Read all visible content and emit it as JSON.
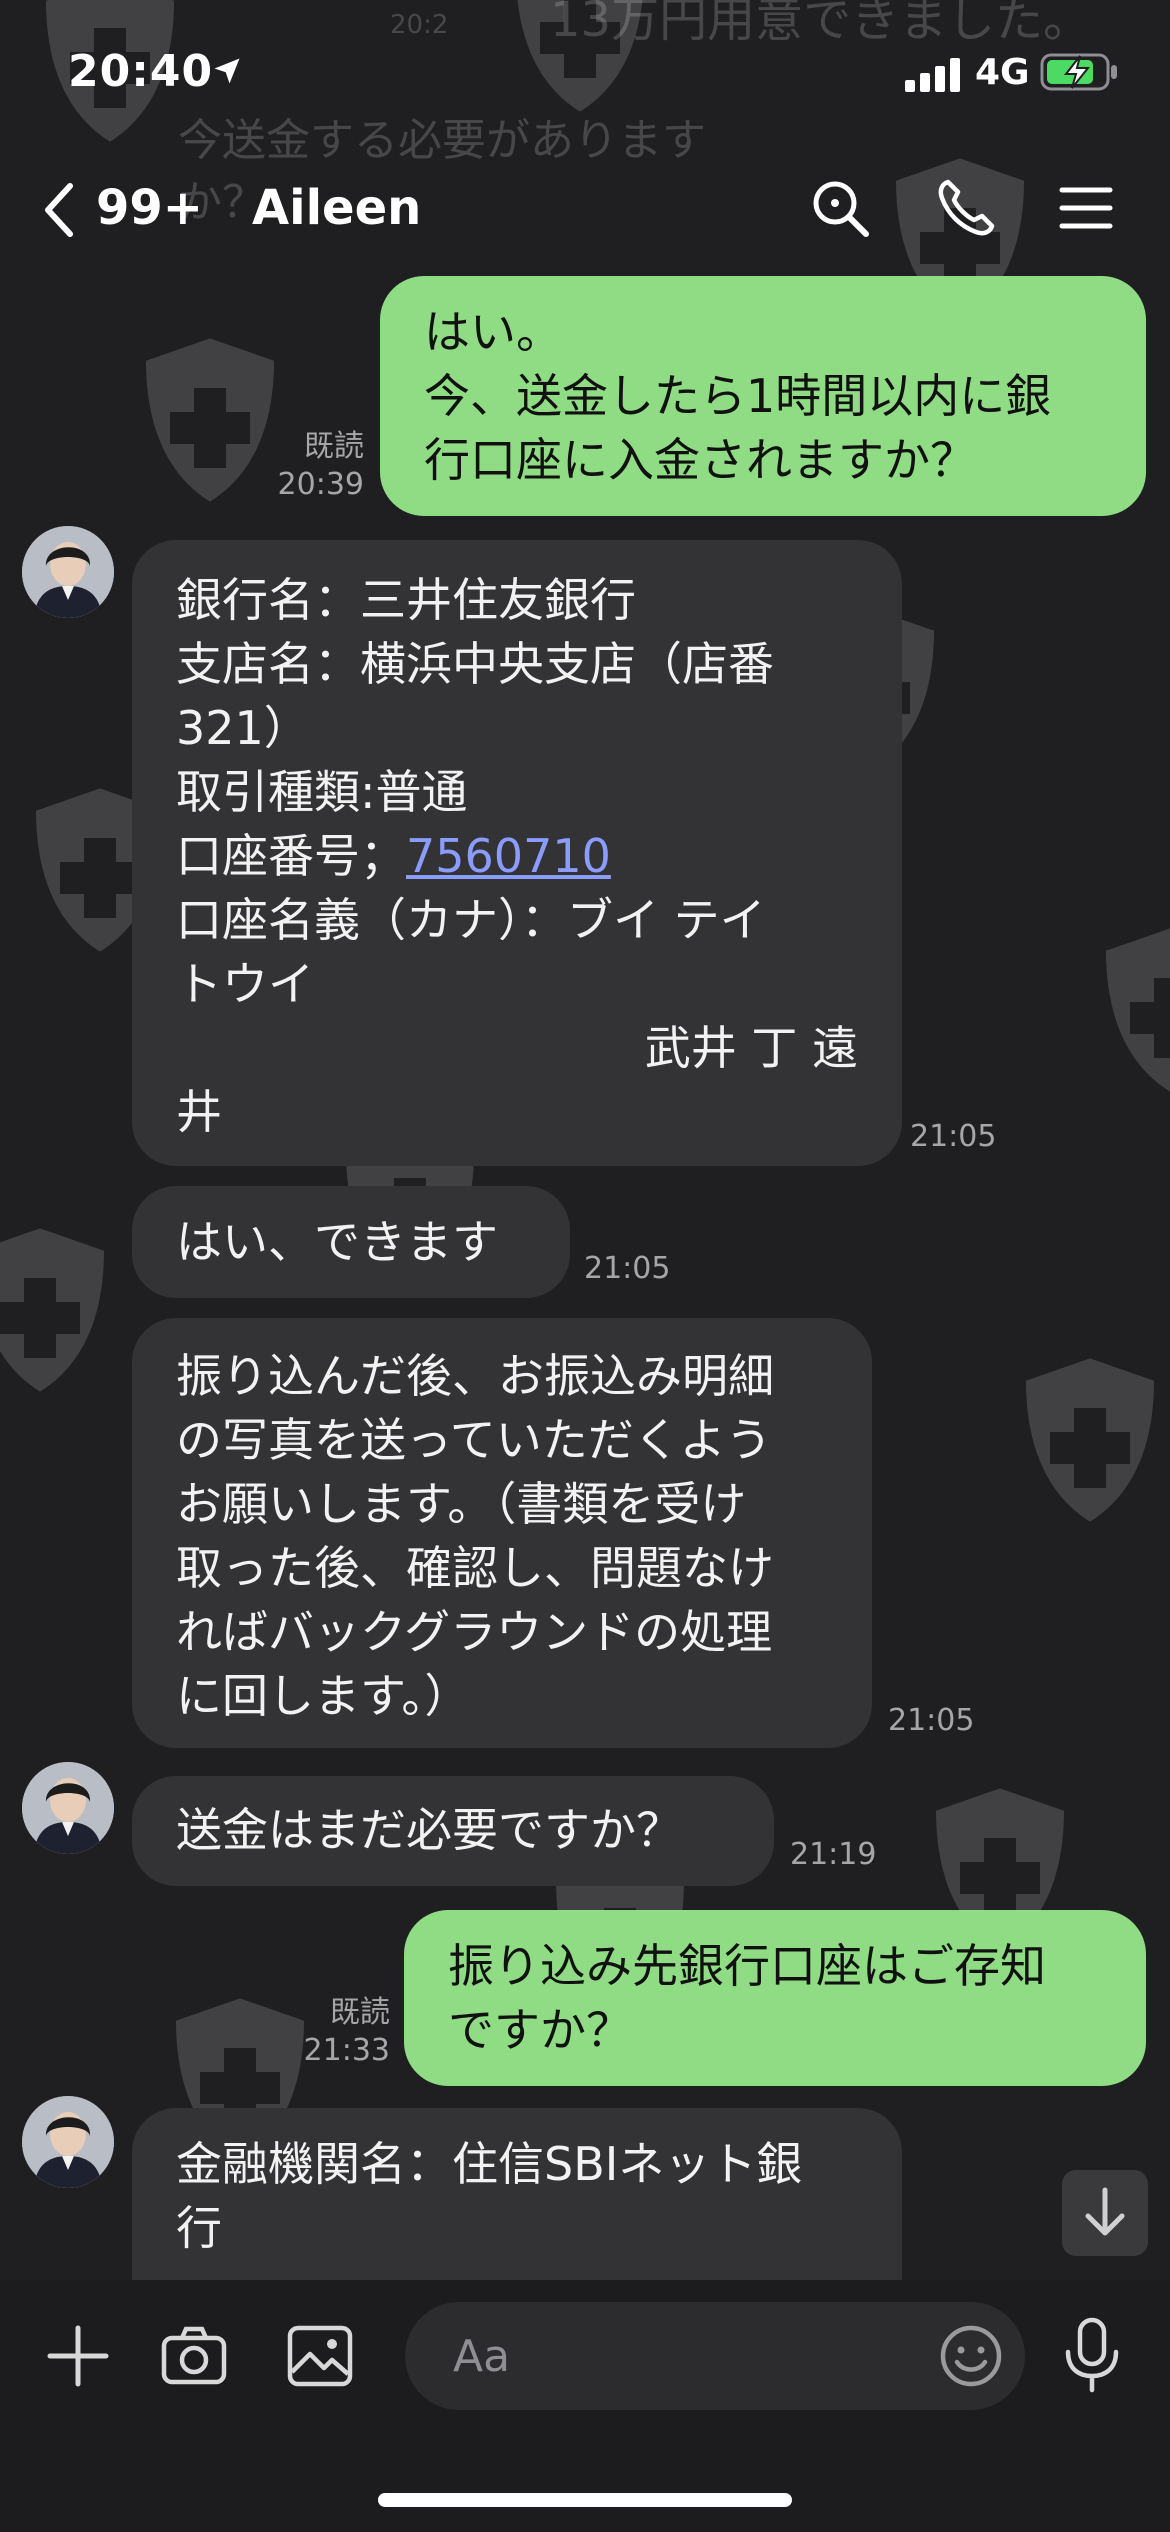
{
  "status_bar": {
    "time": "20:40",
    "network": "4G",
    "icons": [
      "location-arrow-icon",
      "signal-icon",
      "battery-charging-icon"
    ]
  },
  "ghost_overlay": {
    "top_time": "20:2",
    "top_text": "13万円用意できました。",
    "line1": "今送金する必要があります",
    "line2": "か？"
  },
  "header": {
    "back_count": "99+",
    "chat_name": "Aileen",
    "icons": [
      "back-chevron-icon",
      "search-icon",
      "phone-icon",
      "menu-icon"
    ]
  },
  "messages": [
    {
      "id": "m1",
      "direction": "out",
      "read_label": "既読",
      "time": "20:39",
      "lines": [
        "はい。",
        "今、送金したら1時間以内に銀",
        "行口座に入金されますか？"
      ]
    },
    {
      "id": "m2",
      "direction": "in",
      "time": "21:05",
      "lines_before_link": [
        "銀行名：三井住友銀行",
        "支店名：横浜中央支店（店番",
        "321）",
        "取引種類:普通"
      ],
      "account_label": "口座番号；",
      "account_number": "7560710",
      "lines_after_link": [
        "口座名義（カナ）：ブイ テイ",
        "トウイ"
      ],
      "right_aligned_line": "武井 丁 遠",
      "last_line": "井"
    },
    {
      "id": "m3",
      "direction": "in",
      "time": "21:05",
      "lines": [
        "はい、できます"
      ]
    },
    {
      "id": "m4",
      "direction": "in",
      "time": "21:05",
      "lines": [
        "振り込んだ後、お振込み明細",
        "の写真を送っていただくよう",
        "お願いします。（書類を受け",
        "取った後、確認し、問題なけ",
        "ればバックグラウンドの処理",
        "に回します。）"
      ]
    },
    {
      "id": "m5",
      "direction": "in",
      "time": "21:19",
      "lines": [
        "送金はまだ必要ですか？"
      ]
    },
    {
      "id": "m6",
      "direction": "out",
      "read_label": "既読",
      "time": "21:33",
      "lines": [
        "振り込み先銀行口座はご存知",
        "ですか？"
      ]
    },
    {
      "id": "m7",
      "direction": "in",
      "lines": [
        "金融機関名：住信SBIネット銀",
        "行"
      ]
    }
  ],
  "input_bar": {
    "placeholder": "Aa",
    "icons": [
      "plus-icon",
      "camera-icon",
      "image-icon",
      "emoji-icon",
      "microphone-icon"
    ]
  },
  "colors": {
    "background": "#1f1f21",
    "incoming_bubble": "#333335",
    "outgoing_bubble": "#8fdc84",
    "link": "#8b9cff",
    "timestamp": "#a6a6a6"
  }
}
